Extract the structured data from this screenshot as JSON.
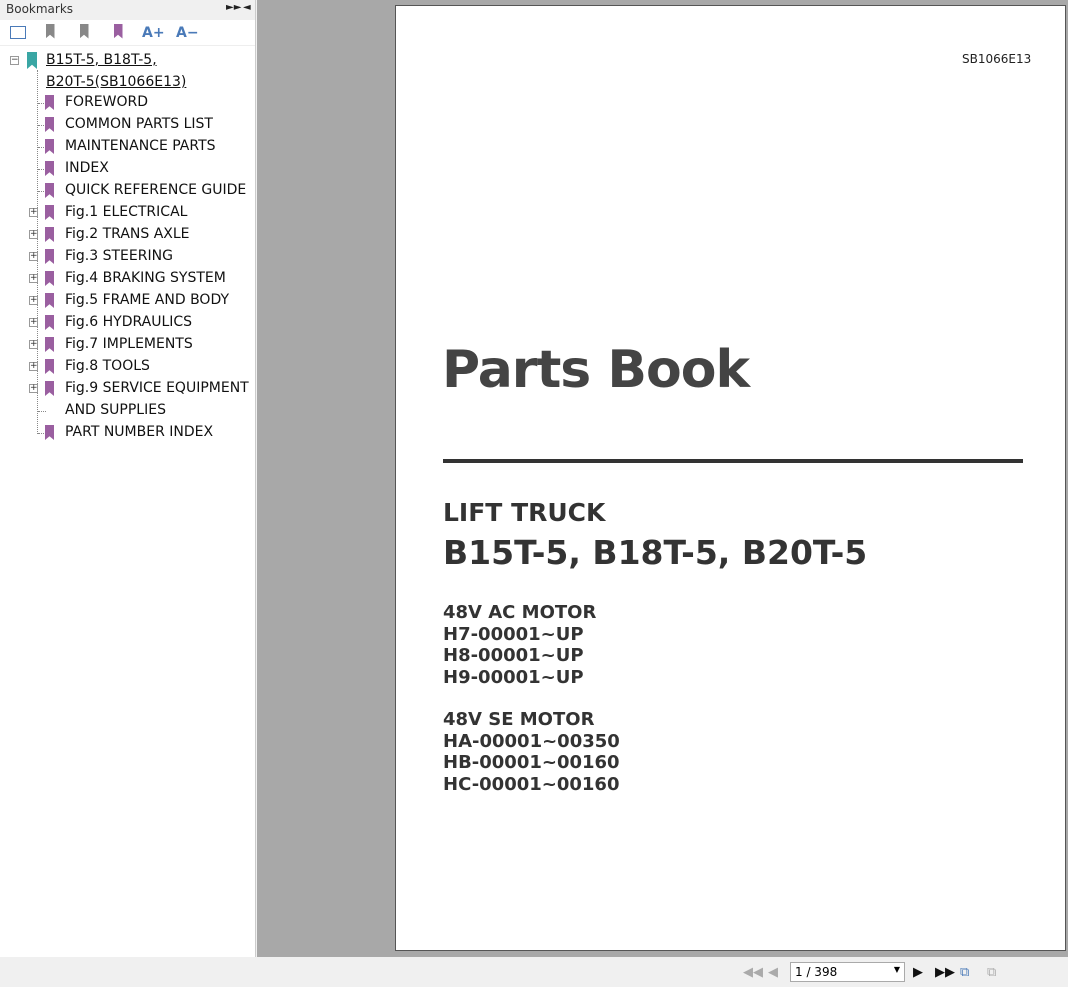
{
  "panel": {
    "title": "Bookmarks",
    "expand_icon": "double-chevron-right-icon",
    "collapse_icon": "triangle-left-icon",
    "tools": [
      "bookmark-options-icon",
      "delete-bookmark-icon",
      "add-bookmark-icon",
      "current-bookmark-icon",
      "enlarge-text-icon",
      "shrink-text-icon"
    ],
    "enlarge_label": "A+",
    "shrink_label": "A−",
    "root": {
      "line1": "B15T-5, B18T-5,",
      "line2": "B20T-5(SB1066E13)"
    },
    "items": [
      {
        "label": "FOREWORD",
        "expandable": false
      },
      {
        "label": "COMMON PARTS LIST",
        "expandable": false
      },
      {
        "label": "MAINTENANCE PARTS",
        "expandable": false
      },
      {
        "label": "INDEX",
        "expandable": false
      },
      {
        "label": "QUICK REFERENCE GUIDE",
        "expandable": false
      },
      {
        "label": "Fig.1 ELECTRICAL",
        "expandable": true
      },
      {
        "label": "Fig.2 TRANS AXLE",
        "expandable": true
      },
      {
        "label": "Fig.3 STEERING",
        "expandable": true
      },
      {
        "label": "Fig.4 BRAKING SYSTEM",
        "expandable": true
      },
      {
        "label": "Fig.5 FRAME AND BODY",
        "expandable": true
      },
      {
        "label": "Fig.6 HYDRAULICS",
        "expandable": true
      },
      {
        "label": "Fig.7 IMPLEMENTS",
        "expandable": true
      },
      {
        "label": "Fig.8 TOOLS",
        "expandable": true
      },
      {
        "label": "Fig.9 SERVICE EQUIPMENT",
        "expandable": true
      },
      {
        "label": "AND SUPPLIES",
        "expandable": false
      },
      {
        "label": "PART NUMBER INDEX",
        "expandable": false
      }
    ]
  },
  "document": {
    "code": "SB1066E13",
    "title": "Parts Book",
    "subtitle": "LIFT TRUCK",
    "models": "B15T-5, B18T-5, B20T-5",
    "ac": [
      "48V  AC MOTOR",
      "H7-00001~UP",
      "H8-00001~UP",
      "H9-00001~UP"
    ],
    "se": [
      "48V  SE MOTOR",
      "HA-00001~00350",
      "HB-00001~00160",
      "HC-00001~00160"
    ]
  },
  "nav": {
    "page": "1 / 398"
  }
}
